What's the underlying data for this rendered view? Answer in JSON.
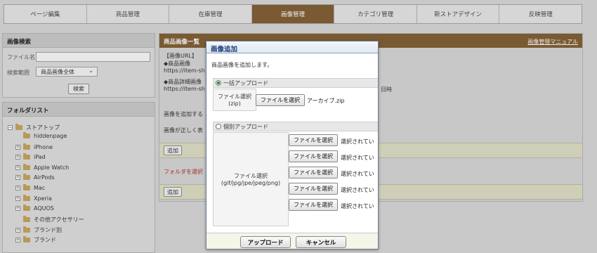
{
  "nav": [
    "ページ編集",
    "商品管理",
    "在庫管理",
    "画像管理",
    "カテゴリ管理",
    "新ストアデザイン",
    "反映管理"
  ],
  "search": {
    "title": "画像検索",
    "filename_label": "ファイル名",
    "range_label": "検索範囲",
    "range_value": "商品画像全体",
    "search_button": "検索"
  },
  "folders": {
    "title": "フォルダリスト",
    "root": "ストアトップ",
    "items": [
      "hiddenpage",
      "iPhone",
      "iPad",
      "Apple Watch",
      "AirPods",
      "Mac",
      "Xperia",
      "AQUOS",
      "その他アクセサリー",
      "ブランド別",
      "ブランド"
    ]
  },
  "main": {
    "title": "商品画像一覧",
    "manual_link": "画像管理マニュアル",
    "lines": [
      "【画像URL】",
      "◆商品画像",
      "https://item-sh",
      "◆商品詳細画像",
      "https://item-sh"
    ],
    "date_fragment": "日時",
    "add_note": "画像を追加する",
    "correct_note": "画像が正しく表",
    "add_button": "追加",
    "folder_warning": "フォルダを選択",
    "add_button2": "追加"
  },
  "modal": {
    "title": "画像追加",
    "description": "商品画像を追加します。",
    "bulk_label": "一括アップロード",
    "bulk_file_label": "ファイル選択\n(zip)",
    "file_button": "ファイルを選択",
    "bulk_file_name": "アーカイブ.zip",
    "individual_label": "個別アップロード",
    "individual_file_label": "ファイル選択\n(gif/jpg/jpe/jpeg/png)",
    "not_selected": "選択されてい",
    "upload_button": "アップロード",
    "cancel_button": "キャンセル"
  }
}
